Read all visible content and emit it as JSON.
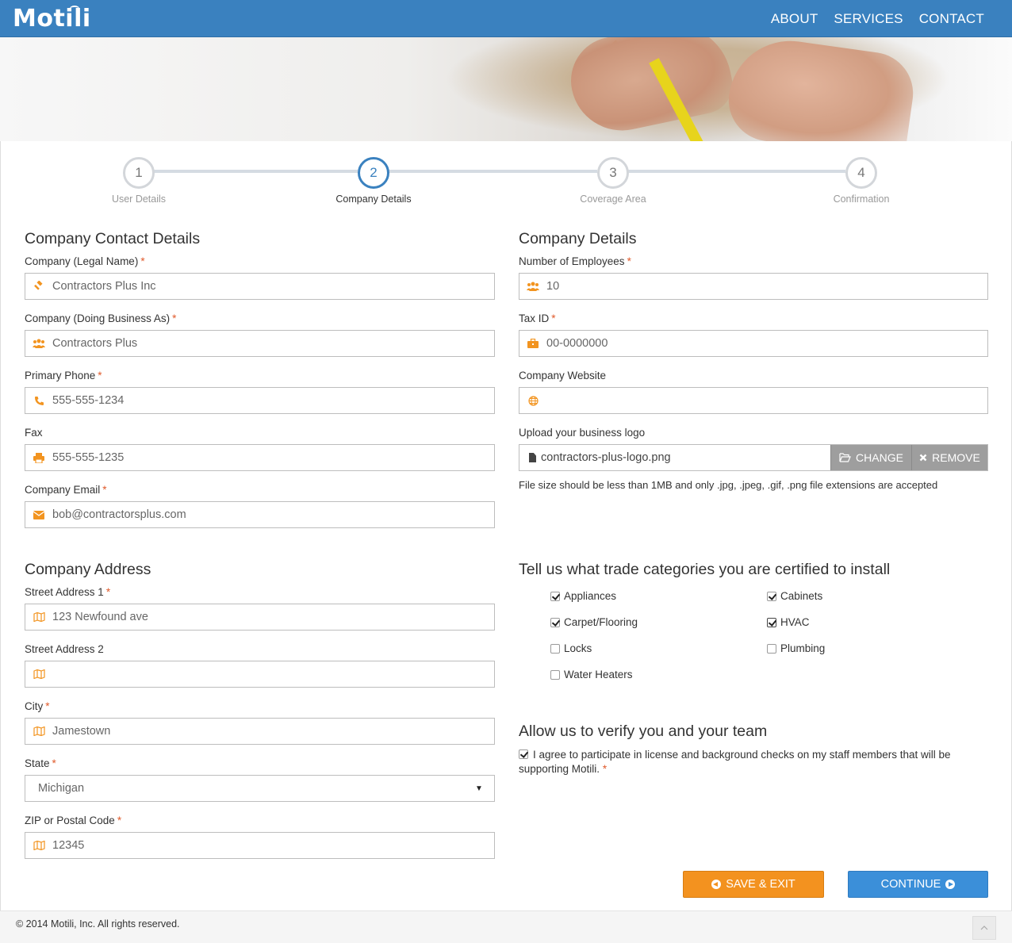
{
  "header": {
    "logo": "Motili",
    "nav": [
      "ABOUT",
      "SERVICES",
      "CONTACT"
    ]
  },
  "steps": [
    {
      "number": "1",
      "label": "User Details"
    },
    {
      "number": "2",
      "label": "Company Details"
    },
    {
      "number": "3",
      "label": "Coverage Area"
    },
    {
      "number": "4",
      "label": "Confirmation"
    }
  ],
  "contact": {
    "title": "Company Contact Details",
    "legal_name": {
      "label": "Company (Legal Name)",
      "value": "Contractors Plus Inc"
    },
    "dba": {
      "label": "Company (Doing Business As)",
      "value": "Contractors Plus"
    },
    "phone": {
      "label": "Primary Phone",
      "value": "555-555-1234"
    },
    "fax": {
      "label": "Fax",
      "value": "555-555-1235"
    },
    "email": {
      "label": "Company Email",
      "value": "bob@contractorsplus.com"
    }
  },
  "company": {
    "title": "Company Details",
    "employees": {
      "label": "Number of Employees",
      "value": "10"
    },
    "tax_id": {
      "label": "Tax ID",
      "value": "00-0000000"
    },
    "website": {
      "label": "Company Website",
      "value": ""
    },
    "logo": {
      "label": "Upload your business logo",
      "filename": "contractors-plus-logo.png",
      "change": "CHANGE",
      "remove": "REMOVE",
      "note": "File size should be less than 1MB and only .jpg, .jpeg, .gif, .png file extensions are accepted"
    }
  },
  "address": {
    "title": "Company Address",
    "street1": {
      "label": "Street Address 1",
      "value": "123 Newfound ave"
    },
    "street2": {
      "label": "Street Address 2",
      "value": ""
    },
    "city": {
      "label": "City",
      "value": "Jamestown"
    },
    "state": {
      "label": "State",
      "value": "Michigan"
    },
    "zip": {
      "label": "ZIP or Postal Code",
      "value": "12345"
    }
  },
  "trades": {
    "title": "Tell us what trade categories you are certified to install",
    "items": [
      {
        "label": "Appliances",
        "checked": true
      },
      {
        "label": "Cabinets",
        "checked": true
      },
      {
        "label": "Carpet/Flooring",
        "checked": true
      },
      {
        "label": "HVAC",
        "checked": true
      },
      {
        "label": "Locks",
        "checked": false
      },
      {
        "label": "Plumbing",
        "checked": false
      },
      {
        "label": "Water Heaters",
        "checked": false
      }
    ]
  },
  "verify": {
    "title": "Allow us to verify you and your team",
    "agree_text": "I agree to participate in license and background checks on my staff members that will be supporting Motili.",
    "required": "*"
  },
  "actions": {
    "save": "SAVE & EXIT",
    "continue": "CONTINUE"
  },
  "footer": {
    "copyright": "© 2014 Motili, Inc. All rights reserved."
  },
  "colors": {
    "brand_blue": "#3a81bf",
    "accent_orange": "#f3921f",
    "continue_blue": "#3b8fd9",
    "required_red": "#e05a2b"
  }
}
